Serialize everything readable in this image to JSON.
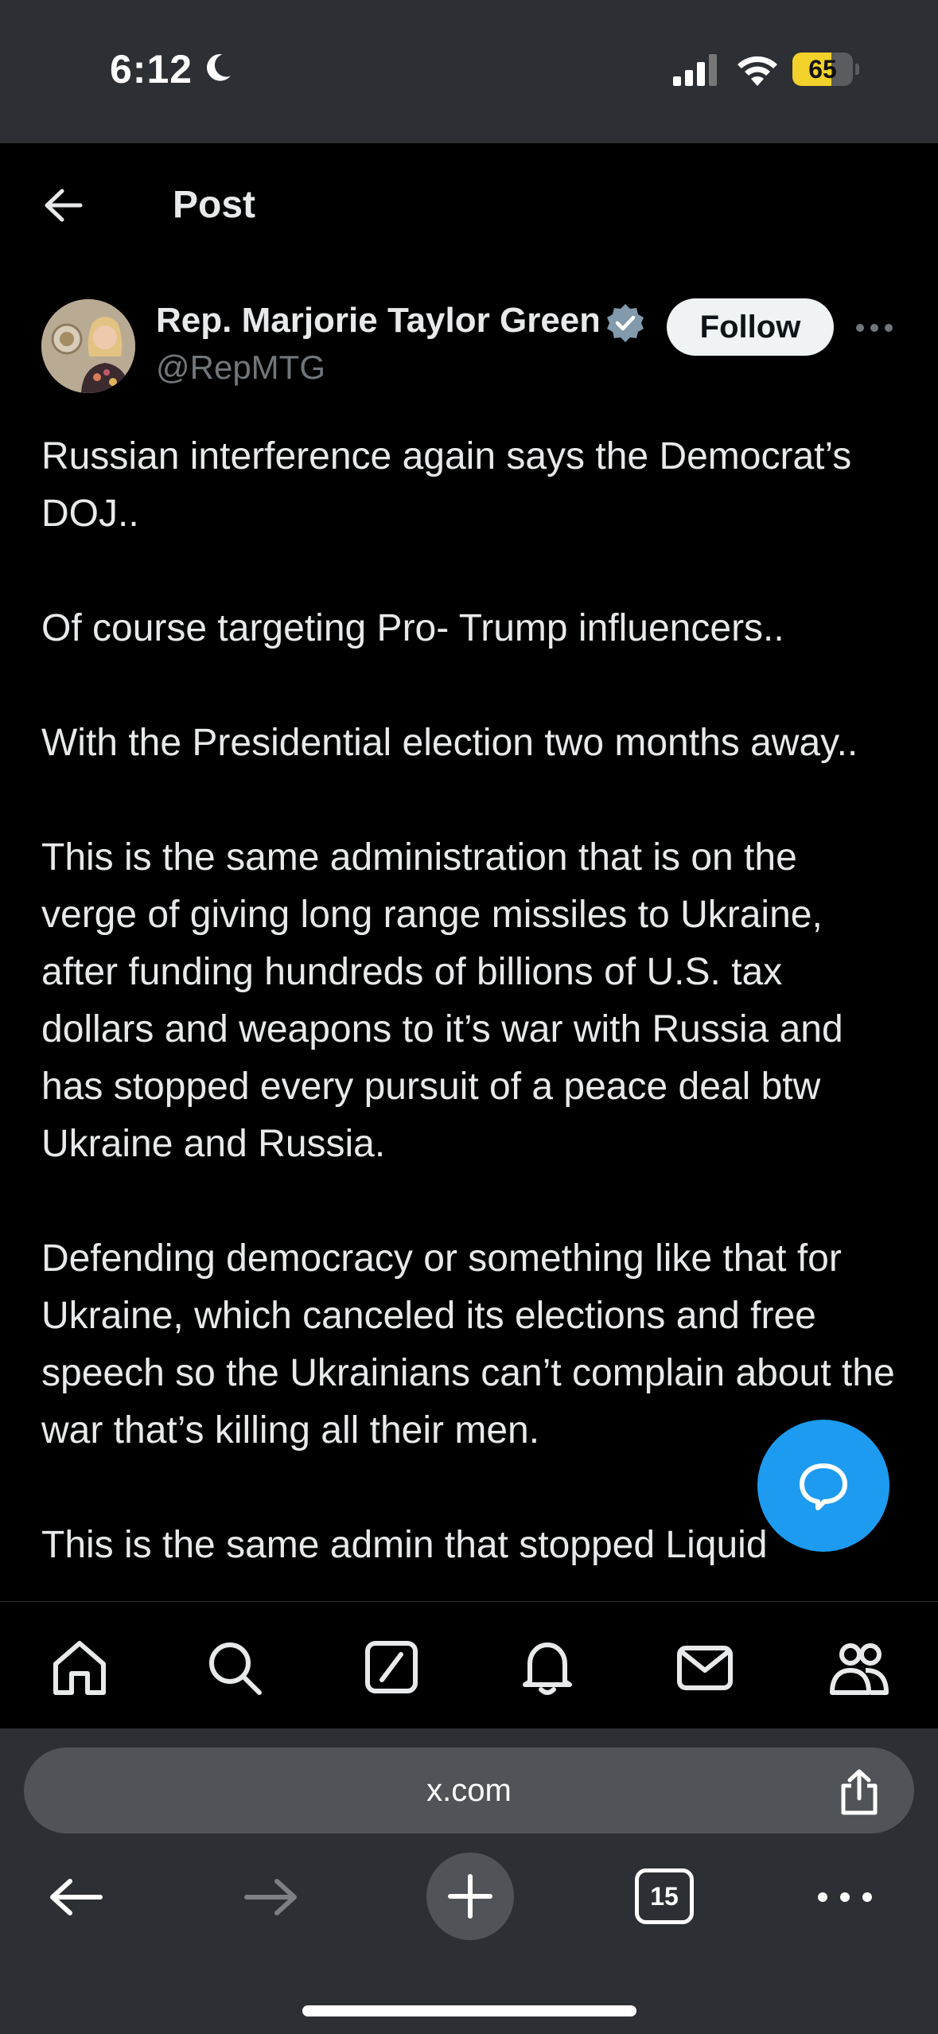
{
  "status_bar": {
    "time": "6:12",
    "battery_level": "65"
  },
  "header": {
    "title": "Post"
  },
  "author": {
    "name": "Rep. Marjorie Taylor Greene",
    "handle": "@RepMTG",
    "follow_label": "Follow"
  },
  "post": {
    "paragraphs": [
      "Russian interference again says the Democrat’s DOJ..",
      "Of course targeting Pro- Trump influencers..",
      "With the Presidential election two months away..",
      "This is the same administration that is on the verge of giving long range missiles to Ukraine, after funding hundreds of billions of U.S. tax dollars and weapons to it’s war with Russia and has stopped every pursuit of a peace deal btw Ukraine and Russia.",
      "Defending democracy or something like that for Ukraine, which canceled its elections and free speech so the Ukrainians can’t complain about the war that’s killing all their men.",
      "This is the same admin that stopped Liquid"
    ]
  },
  "bottom_nav": {
    "items": [
      "home-icon",
      "search-icon",
      "grok-icon",
      "notifications-icon",
      "messages-icon",
      "communities-icon"
    ]
  },
  "browser": {
    "url": "x.com",
    "tab_count": "15"
  },
  "colors": {
    "accent": "#1d9bf0",
    "background": "#000000",
    "text": "#e7e9ea",
    "secondary_text": "#71767b",
    "chrome": "#2c2f33"
  }
}
